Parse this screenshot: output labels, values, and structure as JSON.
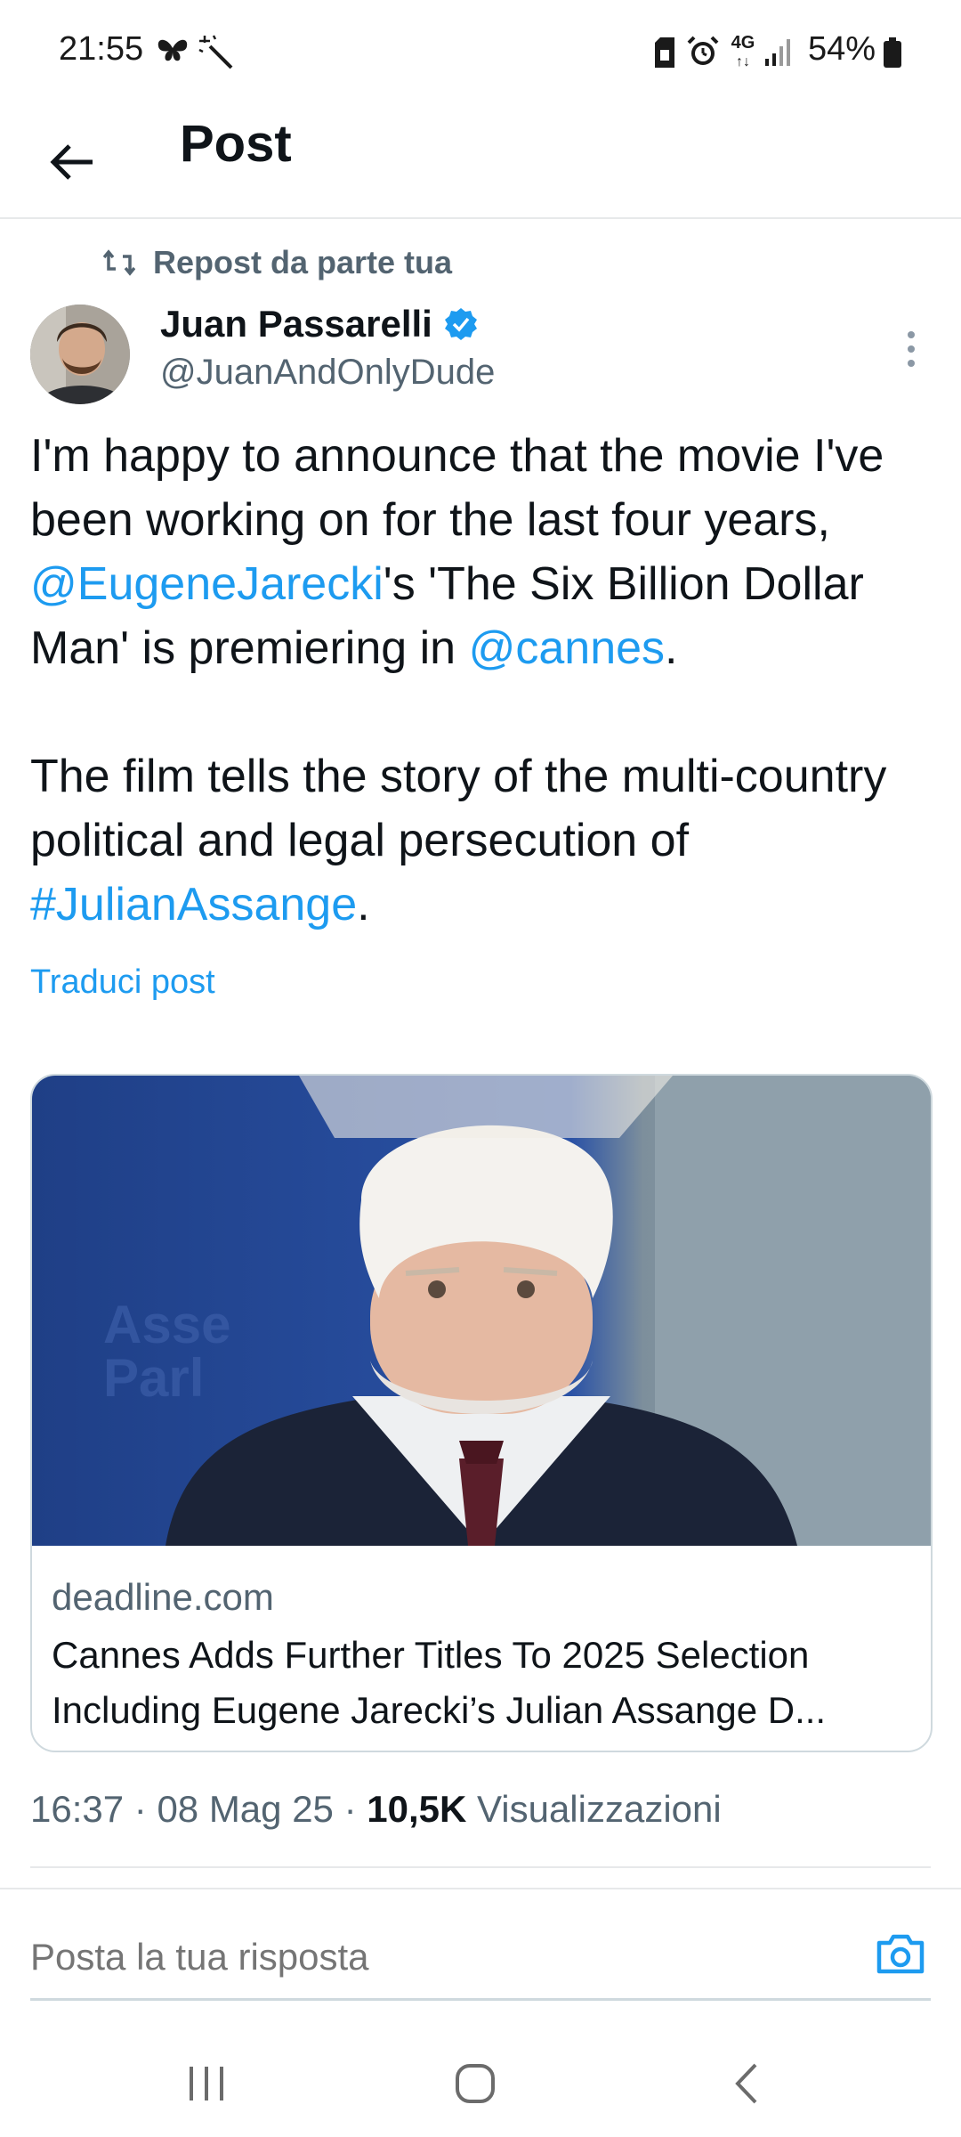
{
  "status_bar": {
    "time": "21:55",
    "battery": "54%",
    "network": "4G"
  },
  "header": {
    "title": "Post"
  },
  "repost": {
    "label": "Repost da parte tua"
  },
  "author": {
    "name": "Juan Passarelli",
    "handle": "@JuanAndOnlyDude",
    "verified": true
  },
  "tweet": {
    "p1_a": "I'm happy to announce that the movie I've been working on for the last four years, ",
    "mention1": "@EugeneJarecki",
    "p1_b": "'s 'The Six Billion Dollar Man' is premiering in ",
    "mention2": "@cannes",
    "p1_c": ".",
    "p2_a": "The film tells the story of the multi-country political and legal persecution of ",
    "hashtag": "#JulianAssange",
    "p2_b": ".",
    "translate": "Traduci post"
  },
  "card": {
    "domain": "deadline.com",
    "title_line1": "Cannes Adds Further Titles To 2025 Selection",
    "title_line2": "Including Eugene Jarecki’s Julian Assange D..."
  },
  "meta": {
    "time": "16:37",
    "date": "08 Mag 25",
    "views_count": "10,5K",
    "views_label": "Visualizzazioni",
    "separator": " · "
  },
  "reply": {
    "placeholder": "Posta la tua risposta"
  },
  "colors": {
    "accent": "#1d9bf0",
    "text": "#0f1419",
    "muted": "#536471",
    "border": "#cfd9de"
  },
  "icons": {
    "back": "arrow-left-icon",
    "repost": "repost-icon",
    "verified": "verified-badge-icon",
    "more": "more-vertical-icon",
    "camera": "camera-icon",
    "nav_recents": "recents-icon",
    "nav_home": "home-icon",
    "nav_back": "nav-back-icon"
  }
}
